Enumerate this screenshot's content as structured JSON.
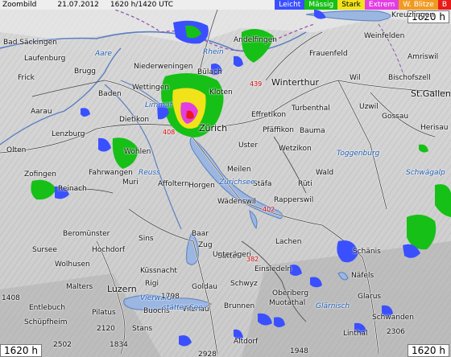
{
  "header": {
    "mode": "Zoombild",
    "date": "21.07.2012",
    "time": "1620 h/1420 UTC",
    "legend": [
      {
        "label": "Leicht",
        "color": "#3a50ff",
        "text_color": "#ffffff"
      },
      {
        "label": "Mässig",
        "color": "#16c016",
        "text_color": "#ffffff"
      },
      {
        "label": "Stark",
        "color": "#f2e21a",
        "text_color": "#000000"
      },
      {
        "label": "Extrem",
        "color": "#e33ee3",
        "text_color": "#ffffff"
      },
      {
        "label": "W. Blitze",
        "color": "#f19a22",
        "text_color": "#ffffff"
      },
      {
        "label": "B",
        "color": "#e81a1a",
        "text_color": "#ffffff"
      }
    ]
  },
  "corner_times": {
    "top_right": "1620 h",
    "bottom_left": "1620 h",
    "bottom_right": "1620 h"
  },
  "places": [
    {
      "name": "Zürich",
      "big": true
    },
    {
      "name": "Winterthur",
      "big": true
    },
    {
      "name": "St.Gallen",
      "big": true
    },
    {
      "name": "Luzern",
      "big": true
    },
    {
      "name": "Bad Säckingen"
    },
    {
      "name": "Laufenburg"
    },
    {
      "name": "Frick"
    },
    {
      "name": "Brugg"
    },
    {
      "name": "Baden"
    },
    {
      "name": "Wettingen"
    },
    {
      "name": "Niederweningen"
    },
    {
      "name": "Bülach"
    },
    {
      "name": "Kloten"
    },
    {
      "name": "Andelfingen"
    },
    {
      "name": "Frauenfeld"
    },
    {
      "name": "Weinfelden"
    },
    {
      "name": "Amriswil"
    },
    {
      "name": "Wil"
    },
    {
      "name": "Bischofszell"
    },
    {
      "name": "Aarau"
    },
    {
      "name": "Lenzburg"
    },
    {
      "name": "Dietikon"
    },
    {
      "name": "Wohlen"
    },
    {
      "name": "Effretikon"
    },
    {
      "name": "Pfäffikon"
    },
    {
      "name": "Bauma"
    },
    {
      "name": "Uster"
    },
    {
      "name": "Wetzikon"
    },
    {
      "name": "Gossau"
    },
    {
      "name": "Herisau"
    },
    {
      "name": "Uzwil"
    },
    {
      "name": "Olten"
    },
    {
      "name": "Zofingen"
    },
    {
      "name": "Reinach"
    },
    {
      "name": "Muri"
    },
    {
      "name": "Affoltern"
    },
    {
      "name": "Horgen"
    },
    {
      "name": "Meilen"
    },
    {
      "name": "Stäfa"
    },
    {
      "name": "Rüti"
    },
    {
      "name": "Wald"
    },
    {
      "name": "Wädenswil"
    },
    {
      "name": "Rapperswil"
    },
    {
      "name": "Lachen"
    },
    {
      "name": "Schänis"
    },
    {
      "name": "Baar"
    },
    {
      "name": "Zug"
    },
    {
      "name": "Sins"
    },
    {
      "name": "Einsiedeln"
    },
    {
      "name": "Näfels"
    },
    {
      "name": "Glarus"
    },
    {
      "name": "Schwyz"
    },
    {
      "name": "Oberiberg"
    },
    {
      "name": "Küssnacht"
    },
    {
      "name": "Sattel"
    },
    {
      "name": "Goldau"
    },
    {
      "name": "Vitznau"
    },
    {
      "name": "Brunnen"
    },
    {
      "name": "Muotathal"
    },
    {
      "name": "Entlebuch"
    },
    {
      "name": "Schüpfheim"
    },
    {
      "name": "Malters"
    },
    {
      "name": "Wolhusen"
    },
    {
      "name": "Hochdorf"
    },
    {
      "name": "Beromünster"
    },
    {
      "name": "Sursee"
    },
    {
      "name": "Rigi"
    },
    {
      "name": "Stans"
    },
    {
      "name": "Buochs"
    },
    {
      "name": "Pilatus"
    },
    {
      "name": "Altdorf"
    },
    {
      "name": "Linthal"
    },
    {
      "name": "Schwanden"
    },
    {
      "name": "Kreuzlingen"
    },
    {
      "name": "Turbenthal"
    },
    {
      "name": "Fahrwangen"
    },
    {
      "name": "Unterägeri"
    }
  ],
  "waters": [
    {
      "name": "Rhein"
    },
    {
      "name": "Aare"
    },
    {
      "name": "Reuss"
    },
    {
      "name": "Limmat"
    },
    {
      "name": "Vierwald-"
    },
    {
      "name": "stätter See"
    },
    {
      "name": "Zürichsee"
    },
    {
      "name": "Glärnisch"
    },
    {
      "name": "Schwägalp"
    },
    {
      "name": "Toggenburg"
    }
  ],
  "elevations": [
    "2120",
    "1798",
    "1408",
    "1834",
    "2928",
    "2502",
    "1948",
    "2306"
  ],
  "routes": [
    "408",
    "439",
    "402",
    "382"
  ],
  "radar_cells": [
    {
      "intensity": "moderate",
      "color": "#16c016"
    },
    {
      "intensity": "light",
      "color": "#3a50ff"
    },
    {
      "intensity": "heavy",
      "color": "#f2e21a"
    },
    {
      "intensity": "extreme",
      "color": "#e33ee3"
    },
    {
      "intensity": "hail",
      "color": "#e81a1a"
    }
  ]
}
